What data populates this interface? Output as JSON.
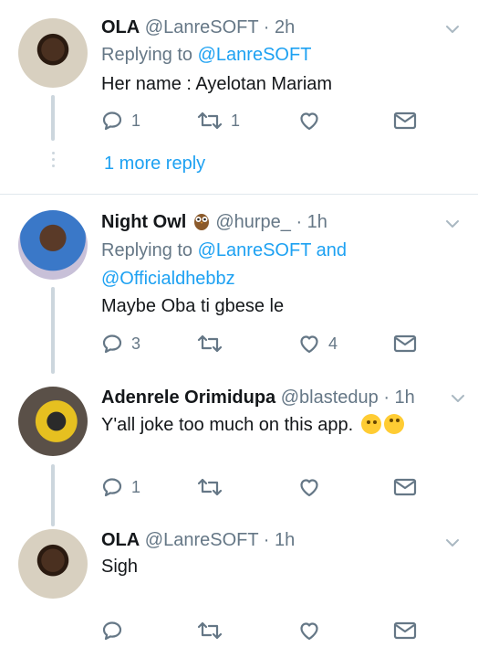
{
  "tweets": [
    {
      "name": "OLA",
      "handle": "@LanreSOFT",
      "time": "· 2h",
      "replying_prefix": "Replying to ",
      "replying_link": "@LanreSOFT",
      "text": "Her name : Ayelotan Mariam",
      "replies": "1",
      "retweets": "1",
      "likes": "",
      "more_reply": "1 more reply"
    },
    {
      "name": "Night Owl",
      "handle": "@hurpe_",
      "time": "· 1h",
      "replying_prefix": "Replying to ",
      "replying_link": "@LanreSOFT and",
      "replying_link2": "@Officialdhebbz",
      "text": "Maybe Oba ti gbese le",
      "replies": "3",
      "retweets": "",
      "likes": "4"
    },
    {
      "name": "Adenrele Orimidupa",
      "handle": "@blastedup",
      "time": "· 1h",
      "text": "Y'all joke too much on this app.",
      "emoji": [
        "thinking-face",
        "rolling-eyes-face"
      ],
      "replies": "1",
      "retweets": "",
      "likes": ""
    },
    {
      "name": "OLA",
      "handle": "@LanreSOFT",
      "time": "· 1h",
      "text": "Sigh",
      "replies": "",
      "retweets": "",
      "likes": ""
    }
  ],
  "colors": {
    "link": "#1da1f2",
    "meta": "#657786",
    "line": "#ccd6dd"
  }
}
